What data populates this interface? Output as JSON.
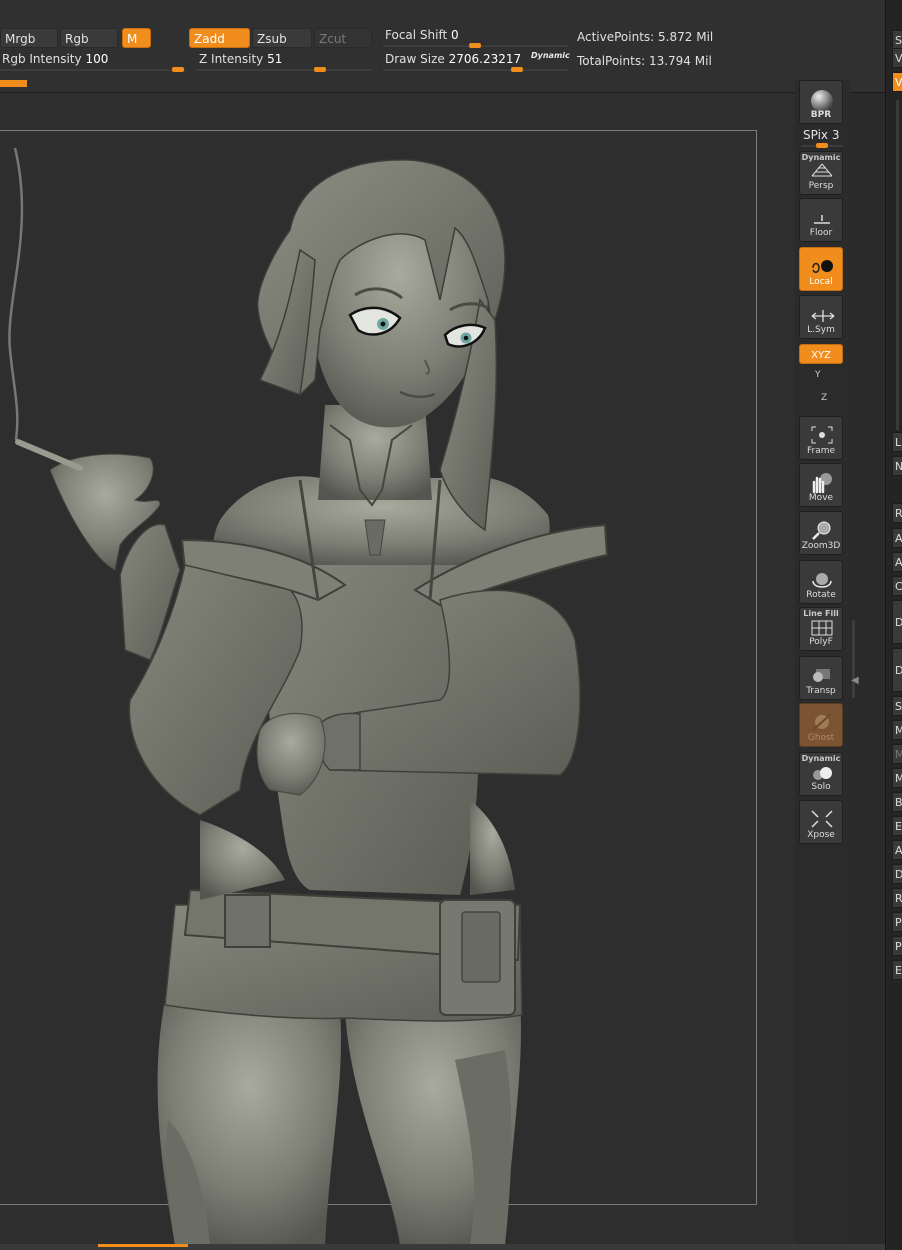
{
  "toolbar": {
    "mrgb": "Mrgb",
    "rgb": "Rgb",
    "m": "M",
    "zadd": "Zadd",
    "zsub": "Zsub",
    "zcut": "Zcut",
    "rgb_intensity_label": "Rgb Intensity",
    "rgb_intensity_value": "100",
    "z_intensity_label": "Z Intensity",
    "z_intensity_value": "51",
    "focal_shift_label": "Focal Shift",
    "focal_shift_value": "0",
    "draw_size_label": "Draw Size",
    "draw_size_value": "2706.23217",
    "dynamic_label": "Dynamic",
    "active_points_label": "ActivePoints:",
    "active_points_value": "5.872 Mil",
    "total_points_label": "TotalPoints:",
    "total_points_value": "13.794 Mil"
  },
  "shelf": {
    "bpr": "BPR",
    "spix_label": "SPix",
    "spix_value": "3",
    "persp_top": "Dynamic",
    "persp": "Persp",
    "floor": "Floor",
    "local": "Local",
    "lsym": "L.Sym",
    "xyz": "XYZ",
    "y": "Y",
    "z": "Z",
    "frame": "Frame",
    "move": "Move",
    "zoom3d": "Zoom3D",
    "rotate": "Rotate",
    "polyf_top": "Line Fill",
    "polyf": "PolyF",
    "transp": "Transp",
    "ghost": "Ghost",
    "solo_top": "Dynamic",
    "solo": "Solo",
    "xpose": "Xpose"
  },
  "right_panel": {
    "letters": [
      "S",
      "V",
      "V",
      "L",
      "N",
      "R",
      "A",
      "A",
      "C",
      "D",
      "D",
      "S",
      "M",
      "M",
      "M",
      "B",
      "E",
      "A",
      "D",
      "R",
      "P",
      "P",
      "E"
    ]
  },
  "colors": {
    "accent": "#f08d1c",
    "canvas_bg": "#2e2e2e",
    "model_gray": "#7a7b72"
  }
}
